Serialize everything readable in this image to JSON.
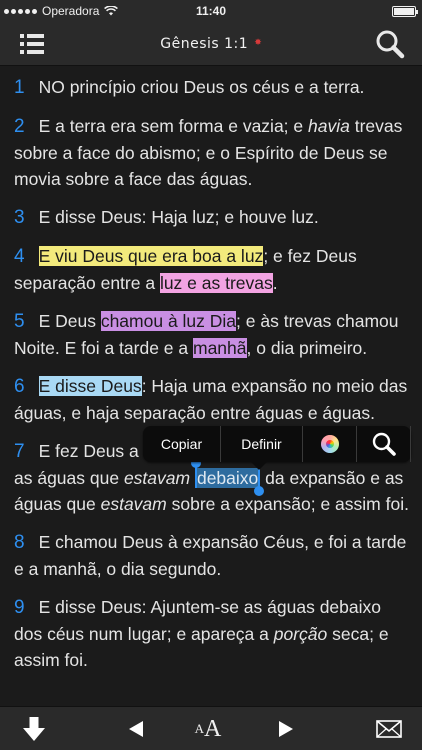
{
  "status_bar": {
    "carrier": "Operadora",
    "time": "11:40",
    "battery_level": 1.0
  },
  "header": {
    "title": "Gênesis 1:1",
    "star_color": "#d93a3a",
    "icons": {
      "menu": "list-menu-icon",
      "search": "search-icon",
      "star": "star-icon"
    }
  },
  "colors": {
    "verse_number": "#2e8ff0",
    "highlight_yellow": "#f3ea7c",
    "highlight_pink": "#f2a3e2",
    "highlight_purple": "#c98fe3",
    "highlight_blue": "#a9d9f4",
    "selection": "#2e6c9f"
  },
  "verses": [
    {
      "num": "1",
      "text": "NO princípio criou Deus os céus e a terra."
    },
    {
      "num": "2",
      "t1": "E a terra era sem forma e vazia; e ",
      "t2": "havia",
      "t3": " trevas sobre a face do abismo; e o Espírito de Deus se movia sobre a face das águas."
    },
    {
      "num": "3",
      "text": "E disse Deus: Haja luz; e houve luz."
    },
    {
      "num": "4",
      "hl1": "E viu Deus que era boa a luz",
      "t1": "; e fez Deus separação entre a ",
      "hl2": "luz e as trevas",
      "t2": "."
    },
    {
      "num": "5",
      "t1": "E Deus ",
      "hl1": "chamou à luz Dia",
      "t2": "; e às trevas chamou Noite. E foi a tarde e a ",
      "hl2": "manhã",
      "t3": ", o dia primeiro."
    },
    {
      "num": "6",
      "hl1": "E disse Deus",
      "t1": ": Haja uma expansão no meio das águas, e haja separação entre águas e águas."
    },
    {
      "num": "7",
      "t1": "E fez Deus a expansão, e fez separação entre as águas que ",
      "t2": "estavam",
      "sel": "debaixo",
      "t3": " da expansão e as águas que ",
      "t4": "estavam",
      "t5": " sobre a expansão; e assim foi."
    },
    {
      "num": "8",
      "text": "E chamou Deus à expansão Céus, e foi a tarde e a manhã, o dia segundo."
    },
    {
      "num": "9",
      "t1": "E disse Deus: Ajuntem-se as águas debaixo dos céus num lugar; e apareça a ",
      "t2": "porção",
      "t3": " seca; e assim foi."
    }
  ],
  "popup_menu": {
    "copy_label": "Copiar",
    "define_label": "Definir",
    "icons": {
      "color": "color-wheel-icon",
      "search": "search-icon"
    }
  },
  "toolbar": {
    "font_small": "A",
    "font_big": "A",
    "icons": {
      "down": "down-arrow-icon",
      "prev": "left-triangle-icon",
      "next": "right-triangle-icon",
      "mail": "mail-icon"
    }
  }
}
